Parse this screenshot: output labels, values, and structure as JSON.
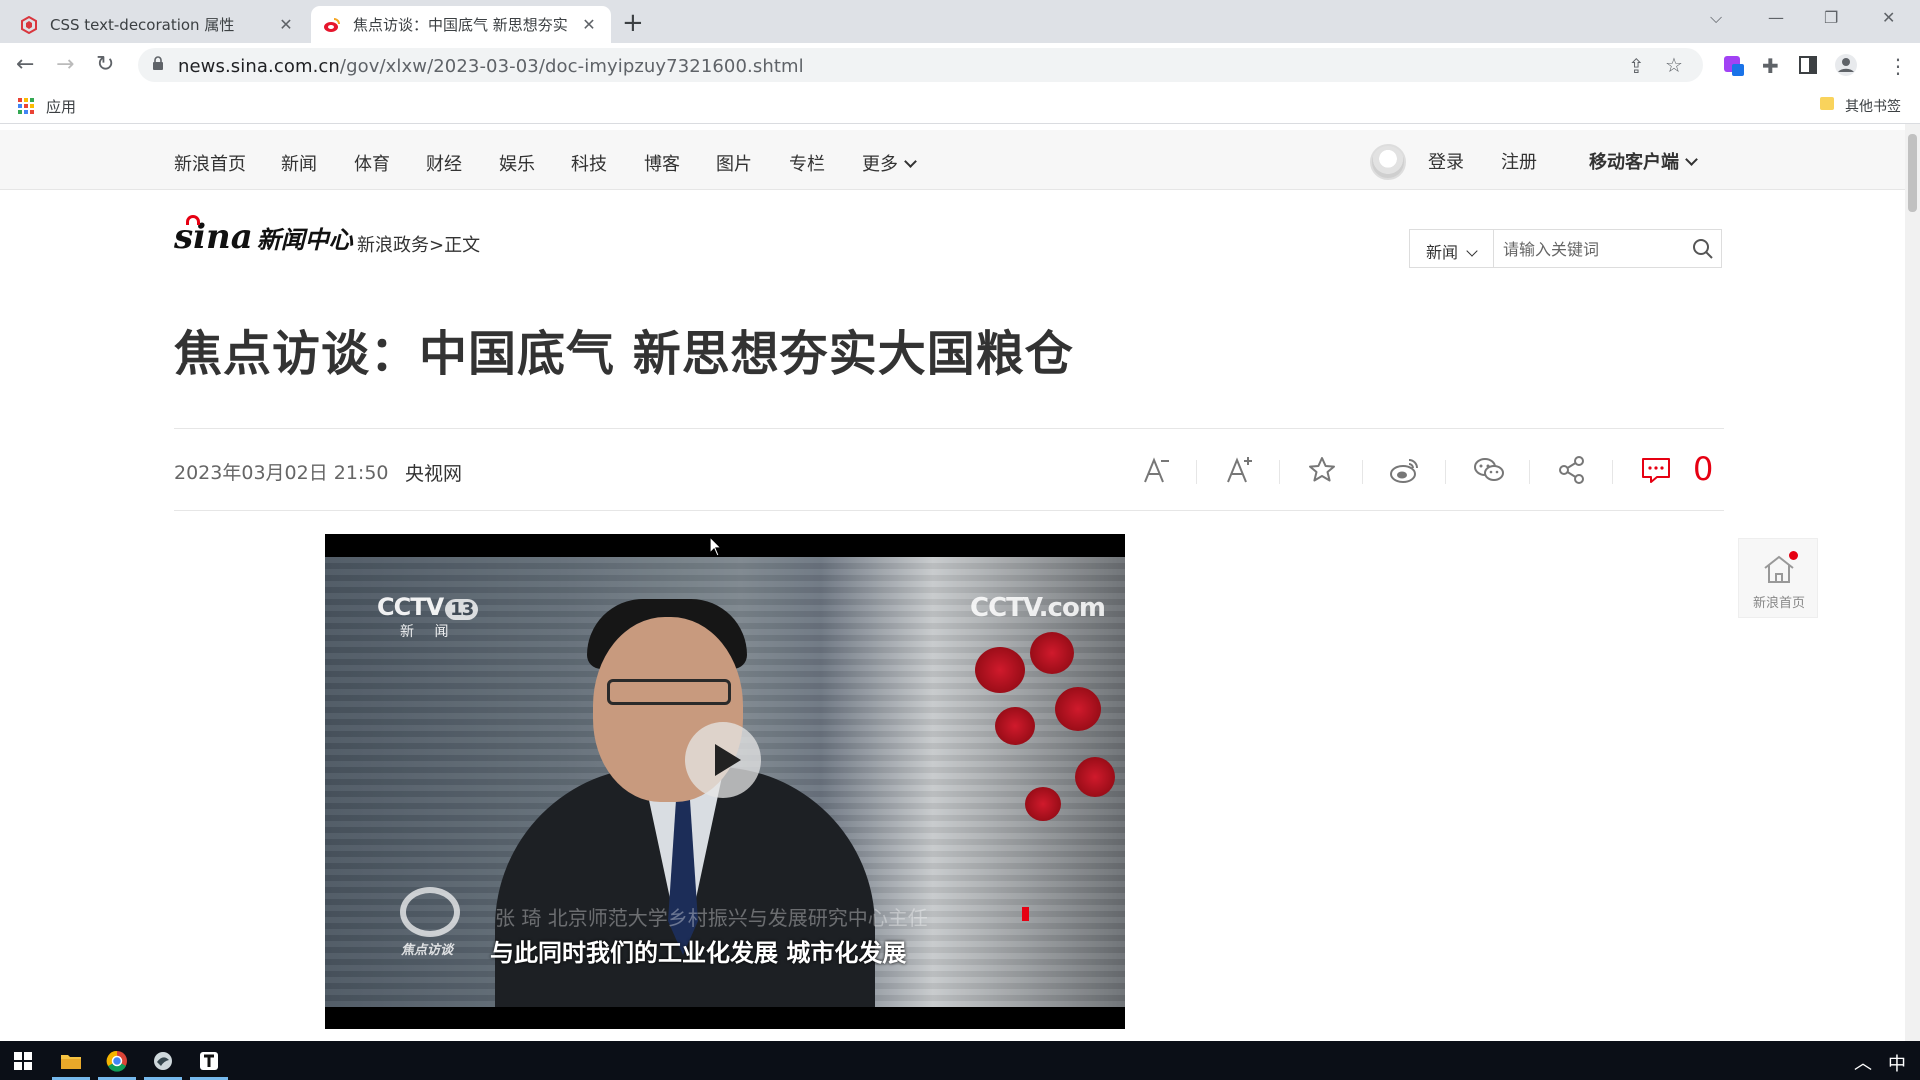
{
  "browser": {
    "tabs": [
      {
        "title": "CSS text-decoration 属性",
        "favicon": "runoob-icon",
        "active": false
      },
      {
        "title": "焦点访谈：中国底气 新思想夯实",
        "favicon": "sina-icon",
        "active": true
      }
    ],
    "url_host": "news.sina.com.cn",
    "url_path": "/gov/xlxw/2023-03-03/doc-imyipzuy7321600.shtml",
    "bookmarks": {
      "apps_label": "应用",
      "other_label": "其他书签"
    }
  },
  "site_nav": {
    "links": [
      "新浪首页",
      "新闻",
      "体育",
      "财经",
      "娱乐",
      "科技",
      "博客",
      "图片",
      "专栏"
    ],
    "more_label": "更多",
    "login_label": "登录",
    "register_label": "注册",
    "mobile_label": "移动客户端"
  },
  "header": {
    "logo_brand": "sina",
    "logo_section": "新闻中心",
    "breadcrumb_section": "新浪政务",
    "breadcrumb_sep": ">",
    "breadcrumb_current": "正文"
  },
  "search": {
    "category": "新闻",
    "placeholder": "请输入关键词"
  },
  "article": {
    "title": "焦点访谈：中国底气 新思想夯实大国粮仓",
    "date": "2023年03月02日 21:50",
    "source": "央视网",
    "comment_count": "0"
  },
  "toolbar_icons": [
    "font-decrease-icon",
    "font-increase-icon",
    "favorite-star-icon",
    "weibo-share-icon",
    "wechat-share-icon",
    "share-icon",
    "comment-icon"
  ],
  "video": {
    "channel_logo": "CCTV",
    "channel_number": "13",
    "channel_sub": "新 闻",
    "watermark": "CCTV.com",
    "program_logo_label": "焦点访谈",
    "caption_name": "张 琦 北京师范大学乡村振兴与发展研究中心主任",
    "caption_main": "与此同时我们的工业化发展  城市化发展"
  },
  "floating": {
    "home_label": "新浪首页"
  },
  "colors": {
    "accent_red": "#e60012",
    "nav_bg": "#f7f7f7",
    "text_dark": "#333333"
  }
}
